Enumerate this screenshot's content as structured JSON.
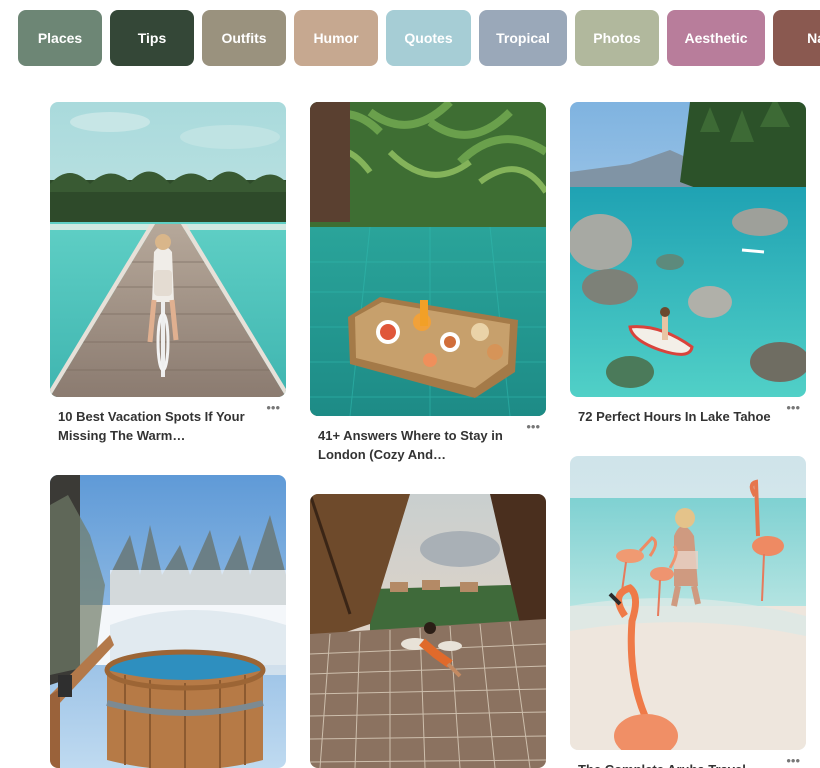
{
  "categories": [
    {
      "label": "Places",
      "color": "#6d8675"
    },
    {
      "label": "Tips",
      "color": "#344737"
    },
    {
      "label": "Outfits",
      "color": "#9a927e"
    },
    {
      "label": "Humor",
      "color": "#c6a890"
    },
    {
      "label": "Quotes",
      "color": "#a6cdd5"
    },
    {
      "label": "Tropical",
      "color": "#9aa8b9"
    },
    {
      "label": "Photos",
      "color": "#b1b89d"
    },
    {
      "label": "Aesthetic",
      "color": "#b87d9b"
    },
    {
      "label": "Nai",
      "color": "#8a5950"
    }
  ],
  "pins": [
    {
      "title": "10 Best Vacation Spots If Your Missing The Warm…",
      "image": "boardwalk-bike-photo"
    },
    {
      "title": "41+ Answers Where to Stay in London (Cozy And…",
      "image": "floating-breakfast-pool-photo"
    },
    {
      "title": "72 Perfect Hours In Lake Tahoe",
      "image": "lake-tahoe-paddleboard-photo"
    },
    {
      "title": "",
      "image": "snowy-hot-tub-photo"
    },
    {
      "title": "",
      "image": "jungle-net-hammock-photo"
    },
    {
      "title": "The Complete Aruba Travel",
      "image": "flamingo-beach-photo"
    }
  ],
  "more_label": "•••"
}
